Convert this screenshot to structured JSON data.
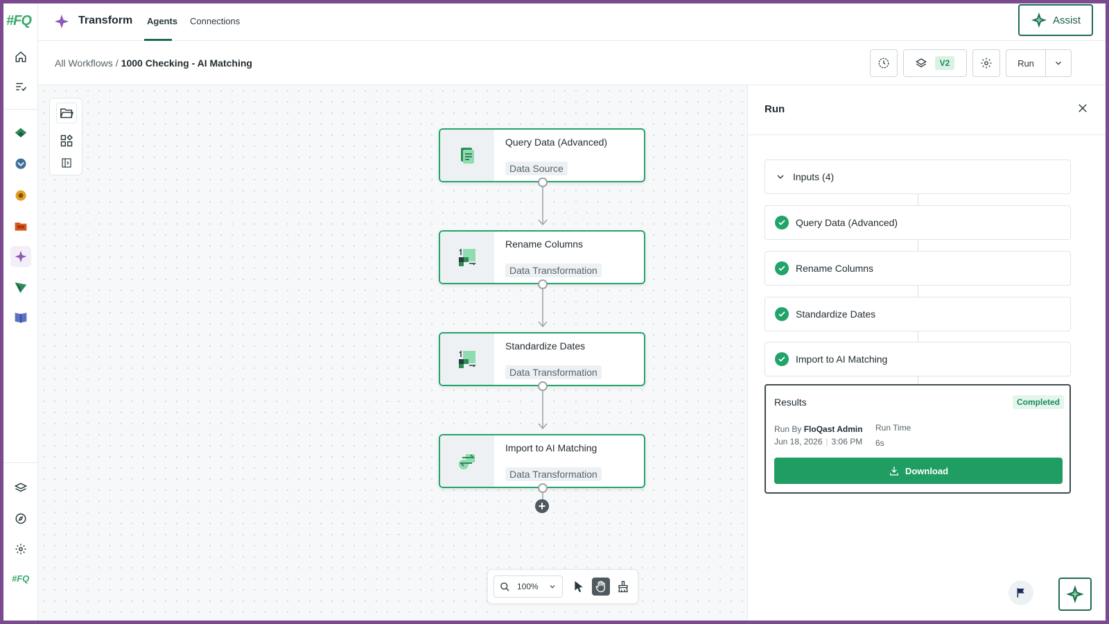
{
  "rail": {
    "logo": "#FQ",
    "footer_logo": "#FQ"
  },
  "topnav": {
    "app_title": "Transform",
    "tabs": [
      {
        "label": "Agents",
        "active": true
      },
      {
        "label": "Connections",
        "active": false
      }
    ],
    "assist_label": "Assist"
  },
  "breadcrumb": {
    "parent": "All Workflows",
    "separator": "/",
    "current": "1000 Checking - AI Matching"
  },
  "toolbar": {
    "version_label": "V2",
    "run_label": "Run"
  },
  "workflow": {
    "nodes": [
      {
        "title": "Query Data (Advanced)",
        "tag": "Data Source",
        "icon": "document-icon"
      },
      {
        "title": "Rename Columns",
        "tag": "Data Transformation",
        "icon": "transform-icon"
      },
      {
        "title": "Standardize Dates",
        "tag": "Data Transformation",
        "icon": "transform-icon"
      },
      {
        "title": "Import to AI Matching",
        "tag": "Data Transformation",
        "icon": "swap-icon"
      }
    ],
    "zoom": "100%"
  },
  "panel": {
    "title": "Run",
    "inputs_label": "Inputs (4)",
    "steps": [
      {
        "label": "Query Data (Advanced)",
        "status": "complete"
      },
      {
        "label": "Rename Columns",
        "status": "complete"
      },
      {
        "label": "Standardize Dates",
        "status": "complete"
      },
      {
        "label": "Import to AI Matching",
        "status": "complete"
      }
    ],
    "results": {
      "title": "Results",
      "status": "Completed",
      "run_by_label": "Run By",
      "run_by": "FloQast Admin",
      "date": "Jun 18, 2026",
      "time": "3:06 PM",
      "run_time_label": "Run Time",
      "run_time": "6s",
      "download_label": "Download"
    }
  },
  "colors": {
    "accent": "#1f9d63",
    "brand": "#1d6b4f",
    "frame": "#7b4a8f",
    "node_border": "#22a36a"
  }
}
